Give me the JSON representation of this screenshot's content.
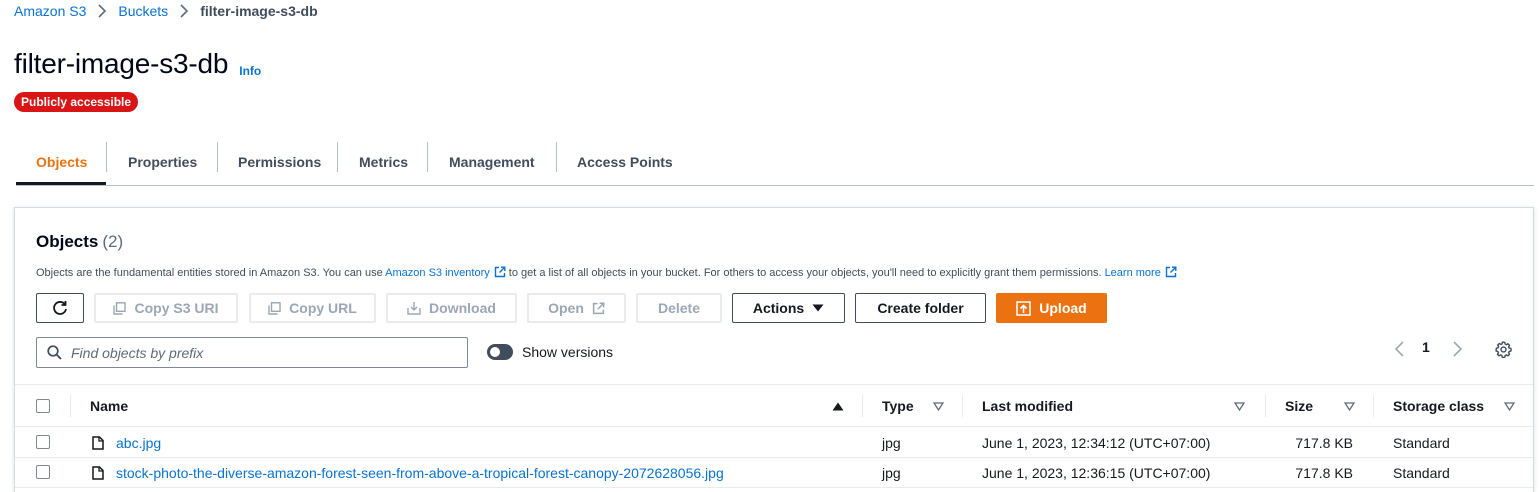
{
  "breadcrumb": {
    "items": [
      "Amazon S3",
      "Buckets"
    ],
    "current": "filter-image-s3-db"
  },
  "header": {
    "title": "filter-image-s3-db",
    "info": "Info",
    "badge": "Publicly accessible"
  },
  "tabs": [
    "Objects",
    "Properties",
    "Permissions",
    "Metrics",
    "Management",
    "Access Points"
  ],
  "objects": {
    "heading": "Objects",
    "count": "(2)",
    "desc_before": "Objects are the fundamental entities stored in Amazon S3. You can use ",
    "desc_link1": "Amazon S3 inventory",
    "desc_middle": " to get a list of all objects in your bucket. For others to access your objects, you'll need to explicitly grant them permissions. ",
    "desc_link2": "Learn more",
    "buttons": {
      "copy_s3_uri": "Copy S3 URI",
      "copy_url": "Copy URL",
      "download": "Download",
      "open": "Open",
      "delete": "Delete",
      "actions": "Actions",
      "create_folder": "Create folder",
      "upload": "Upload"
    },
    "search_placeholder": "Find objects by prefix",
    "show_versions": "Show versions",
    "page": "1",
    "columns": {
      "name": "Name",
      "type": "Type",
      "last_modified": "Last modified",
      "size": "Size",
      "storage_class": "Storage class"
    },
    "rows": [
      {
        "name": "abc.jpg",
        "type": "jpg",
        "last_modified": "June 1, 2023, 12:34:12 (UTC+07:00)",
        "size": "717.8 KB",
        "storage_class": "Standard"
      },
      {
        "name": "stock-photo-the-diverse-amazon-forest-seen-from-above-a-tropical-forest-canopy-2072628056.jpg",
        "type": "jpg",
        "last_modified": "June 1, 2023, 12:36:15 (UTC+07:00)",
        "size": "717.8 KB",
        "storage_class": "Standard"
      }
    ]
  },
  "colors": {
    "link": "#0972d3",
    "accent": "#ec7211",
    "badge": "#d91515"
  }
}
